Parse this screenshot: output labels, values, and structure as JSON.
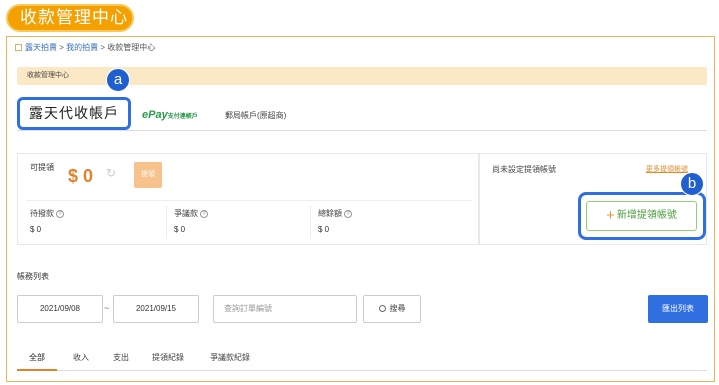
{
  "page": {
    "title": "收款管理中心"
  },
  "breadcrumb": {
    "home": "露天拍賣",
    "sep1": " > ",
    "mine": "我的拍賣",
    "sep2": " > ",
    "current": "收款管理中心"
  },
  "banner": {
    "text": "收款管理中心"
  },
  "tabs": {
    "active": "露天代收帳戶",
    "epay": "ePay",
    "epay_small": "支付連帳戶",
    "post": "郵局帳戶(原超商)"
  },
  "markers": {
    "a": "a",
    "b": "b"
  },
  "balance": {
    "withdrawable_label": "可提領",
    "withdrawable_amount": "$ 0",
    "withdraw_button": "提領",
    "pending_label": "待撥款",
    "pending_value": "$ 0",
    "dispute_label": "爭議款",
    "dispute_value": "$ 0",
    "total_label": "總餘額",
    "total_value": "$ 0"
  },
  "account": {
    "notice": "尚未設定提領帳號",
    "more_link": "更多提領帳號",
    "add_button": "新增提領帳號"
  },
  "list": {
    "title": "帳務列表",
    "date_from": "2021/09/08",
    "date_to": "2021/09/15",
    "tilde": "~",
    "search_placeholder": "查詢訂單編號",
    "search_button": "搜尋",
    "export_button": "匯出列表"
  },
  "subtabs": [
    "全部",
    "收入",
    "支出",
    "提領紀錄",
    "爭議款紀錄"
  ],
  "colors": {
    "accent": "#f3a000",
    "highlight": "#2f6fe0",
    "amount": "#e0822a"
  }
}
